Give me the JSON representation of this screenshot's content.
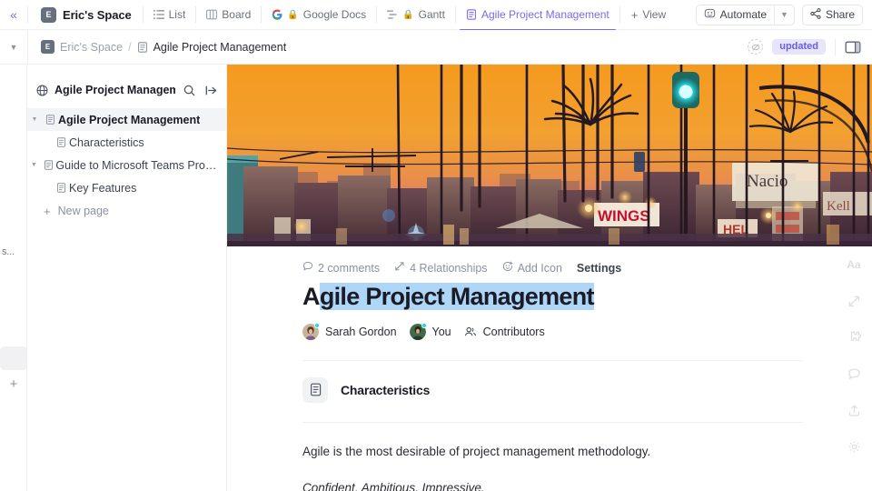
{
  "topbar": {
    "collapse_icon": "double-chevron-left-icon",
    "space_initial": "E",
    "space_name": "Eric's Space",
    "tabs": [
      {
        "label": "List",
        "icon": "list-icon",
        "locked": false,
        "active": false
      },
      {
        "label": "Board",
        "icon": "board-icon",
        "locked": false,
        "active": false
      },
      {
        "label": "Google Docs",
        "icon": "google-icon",
        "locked": true,
        "active": false
      },
      {
        "label": "Gantt",
        "icon": "gantt-icon",
        "locked": true,
        "active": false
      },
      {
        "label": "Agile Project Management",
        "icon": "doc-icon",
        "locked": false,
        "active": true
      }
    ],
    "add_view_label": "View",
    "automate_label": "Automate",
    "share_label": "Share",
    "accent_color": "#7b68ee"
  },
  "breadcrumb": {
    "caret_icon": "chevron-down-icon",
    "space_initial": "E",
    "space": "Eric's Space",
    "separator": "/",
    "doc": "Agile Project Management",
    "status_badge": "updated",
    "badge_color": "#6b5ce0",
    "eye_icon": "eye-off-icon",
    "panel_toggle_icon": "right-panel-icon"
  },
  "left_rail": {
    "truncated_label": "s...",
    "add_icon": "plus-icon"
  },
  "doc_sidebar": {
    "globe_icon": "globe-icon",
    "title": "Agile Project Management",
    "search_icon": "search-icon",
    "collapse_icon": "collapse-panel-icon",
    "tree": [
      {
        "label": "Agile Project Management",
        "level": 0,
        "selected": true,
        "bold": true,
        "twisty": true
      },
      {
        "label": "Characteristics",
        "level": 1,
        "selected": false,
        "bold": false,
        "twisty": false
      },
      {
        "label": "Guide to Microsoft Teams Project...",
        "level": 0,
        "selected": false,
        "bold": false,
        "twisty": true
      },
      {
        "label": "Key Features",
        "level": 1,
        "selected": false,
        "bold": false,
        "twisty": false
      }
    ],
    "new_page_label": "New page"
  },
  "document": {
    "cover_alt": "sunset-city-street-palm-trees-cover",
    "meta": [
      {
        "label": "2 comments",
        "icon": "comment-icon",
        "strong": false
      },
      {
        "label": "4 Relationships",
        "icon": "relationships-icon",
        "strong": false
      },
      {
        "label": "Add Icon",
        "icon": "add-emoji-icon",
        "strong": false
      },
      {
        "label": "Settings",
        "icon": "",
        "strong": true
      }
    ],
    "title_first_char": "A",
    "title_selected_text": "gile Project Management",
    "title_full": "Agile Project Management",
    "selection_color": "#aed6f6",
    "people": [
      {
        "name": "Sarah Gordon",
        "online": true
      },
      {
        "name": "You",
        "online": true
      }
    ],
    "contributors_label": "Contributors",
    "contributors_icon": "people-icon",
    "subpage": {
      "label": "Characteristics",
      "icon": "doc-icon"
    },
    "paragraphs": [
      {
        "text": "Agile is the most desirable of project management methodology.",
        "italic": false
      },
      {
        "text": "Confident. Ambitious. Impressive.",
        "italic": true
      }
    ]
  },
  "right_rail": {
    "items": [
      {
        "icon": "font-aa-icon",
        "label": "Aa"
      },
      {
        "icon": "relationships-icon",
        "label": ""
      },
      {
        "icon": "puzzle-icon",
        "label": ""
      },
      {
        "icon": "comment-icon",
        "label": ""
      },
      {
        "icon": "share-upload-icon",
        "label": ""
      },
      {
        "icon": "gear-icon",
        "label": ""
      }
    ]
  }
}
